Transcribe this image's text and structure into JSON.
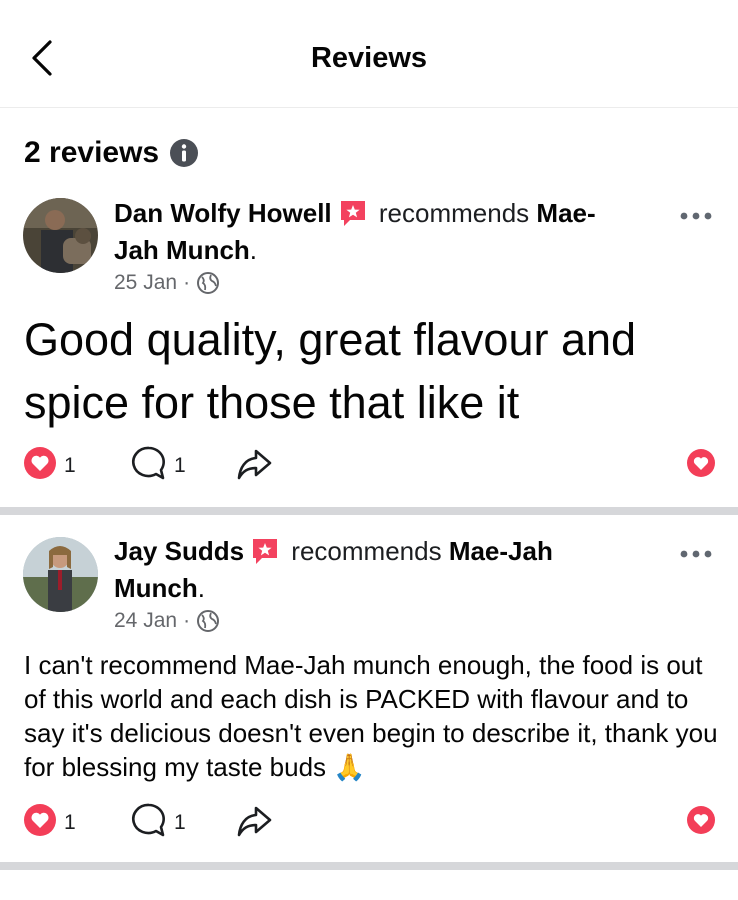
{
  "header": {
    "title": "Reviews",
    "back_icon": "chevron-left-icon"
  },
  "summary": {
    "count_label": "2 reviews",
    "info_icon": "info-icon"
  },
  "reviews": [
    {
      "author": "Dan Wolfy Howell",
      "badge_icon": "recommendation-badge-icon",
      "recommends": "recommends",
      "page_line1": "Mae-",
      "page_line2": "Jah Munch",
      "suffix": ".",
      "date": "25 Jan",
      "separator": "·",
      "audience_icon": "globe-icon",
      "text": "Good quality, great flavour and spice for those that like it",
      "reaction_count": "1",
      "comment_count": "1"
    },
    {
      "author": "Jay Sudds",
      "badge_icon": "recommendation-badge-icon",
      "recommends": "recommends",
      "page_line1": "Mae-Jah",
      "page_line2": "Munch",
      "suffix": ".",
      "date": "24 Jan",
      "separator": "·",
      "audience_icon": "globe-icon",
      "text": "I can't recommend Mae-Jah munch enough, the food is out of this world and each dish is PACKED with flavour and to say it's delicious doesn't even begin to describe it, thank you for blessing my taste buds 🙏",
      "reaction_count": "1",
      "comment_count": "1"
    }
  ],
  "colors": {
    "reaction": "#f33e58",
    "text": "#050505",
    "secondary": "#65676b",
    "divider": "#d6d7da",
    "badge": "#f3425f"
  }
}
